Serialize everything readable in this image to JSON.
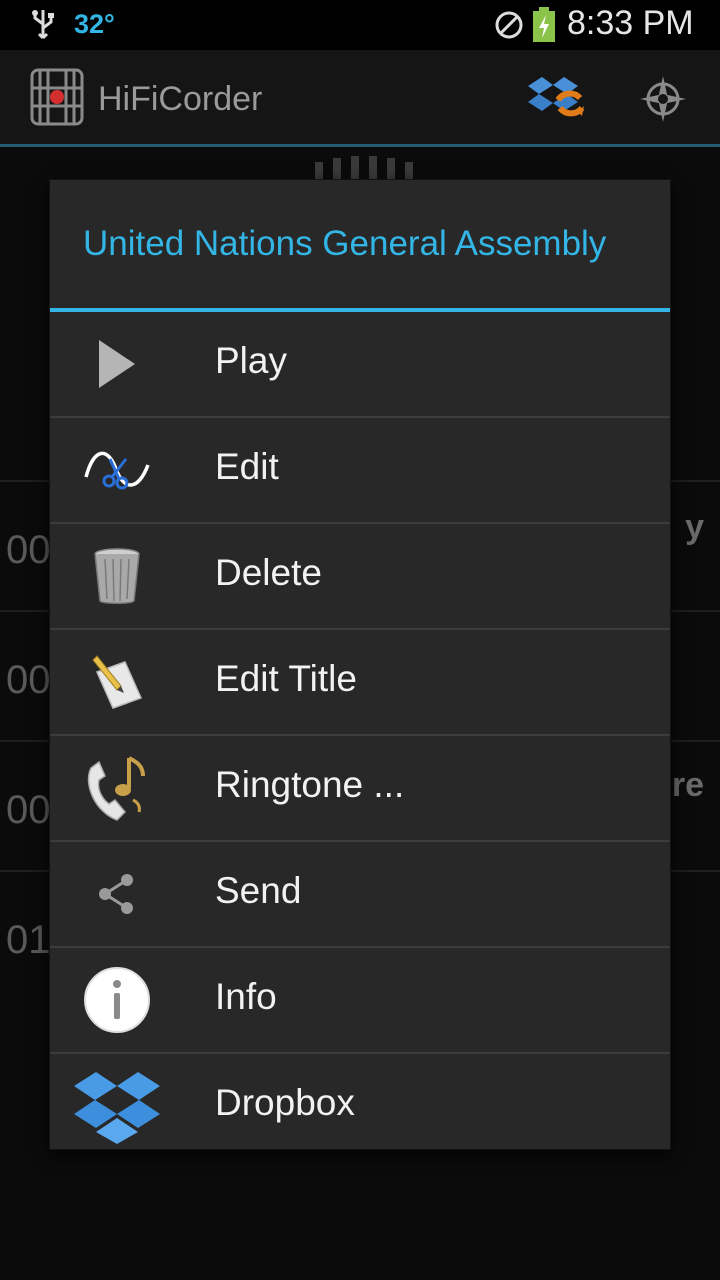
{
  "status_bar": {
    "temperature": "32°",
    "time": "8:33 PM",
    "icons": [
      "usb-icon",
      "do-not-disturb-icon",
      "battery-charging-icon"
    ]
  },
  "action_bar": {
    "title": "HiFiCorder",
    "icons": [
      "app-logo-icon",
      "dropbox-sync-icon",
      "compass-icon"
    ]
  },
  "background_list": {
    "rows": [
      {
        "time": "00",
        "right": "y"
      },
      {
        "time": "00",
        "right": ""
      },
      {
        "time": "00",
        "right": "ure"
      },
      {
        "time": "01",
        "right": ""
      }
    ]
  },
  "dialog": {
    "title": "United Nations General Assembly",
    "items": [
      {
        "label": "Play",
        "icon": "play-icon"
      },
      {
        "label": "Edit",
        "icon": "scissors-waveform-icon"
      },
      {
        "label": "Delete",
        "icon": "trash-bin-icon"
      },
      {
        "label": "Edit Title",
        "icon": "pencil-paper-icon"
      },
      {
        "label": "Ringtone ...",
        "icon": "phone-music-icon"
      },
      {
        "label": "Send",
        "icon": "share-icon"
      },
      {
        "label": "Info",
        "icon": "info-icon"
      },
      {
        "label": "Dropbox",
        "icon": "dropbox-icon"
      }
    ]
  },
  "colors": {
    "accent": "#33b5e5",
    "dialog_bg": "#282828",
    "divider": "#3c3c3c"
  }
}
